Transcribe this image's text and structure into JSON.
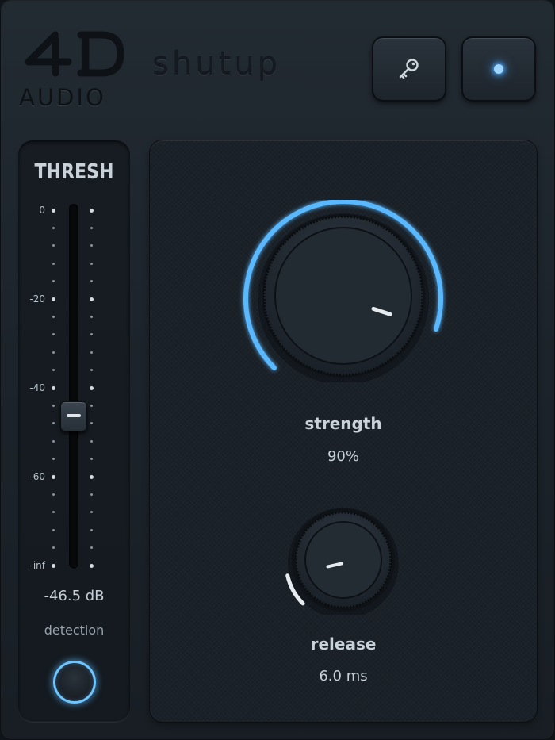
{
  "brand": {
    "logo_mark": "4D",
    "logo_text": "AUDIO",
    "product_name": "shutup"
  },
  "header": {
    "key_button": {
      "icon": "key-icon"
    },
    "power_button": {
      "icon": "led-indicator",
      "state": "on",
      "led_color": "#4aa8ff"
    }
  },
  "threshold": {
    "title": "THRESH",
    "scale_labels": [
      "0",
      "-20",
      "-40",
      "-60",
      "-inf"
    ],
    "value": "-46.5 dB",
    "value_db": -46.5,
    "detection_label": "detection",
    "detection_active": true
  },
  "knobs": {
    "strength": {
      "label": "strength",
      "value": "90%",
      "fraction": 0.9
    },
    "release": {
      "label": "release",
      "value": "6.0 ms",
      "fraction": 0.12
    }
  },
  "colors": {
    "accent": "#4aa8ff",
    "panel": "#1a2128",
    "text": "#c9d1d9"
  }
}
